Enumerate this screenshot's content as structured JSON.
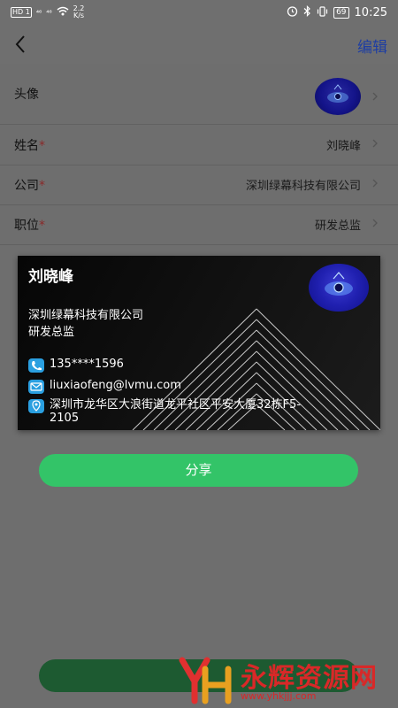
{
  "status_bar": {
    "hd_badge": "HD 1",
    "signal_1": "⁴⁶",
    "signal_2": "⁴⁶",
    "net_speed_value": "2.2",
    "net_speed_unit": "K/s",
    "battery": "69",
    "time": "10:25"
  },
  "header": {
    "edit_label": "编辑"
  },
  "profile": {
    "avatar_label": "头像",
    "fields": [
      {
        "label": "姓名",
        "required_mark": "*",
        "value": "刘晓峰"
      },
      {
        "label": "公司",
        "required_mark": "*",
        "value": "深圳绿幕科技有限公司"
      },
      {
        "label": "职位",
        "required_mark": "*",
        "value": "研发总监"
      }
    ]
  },
  "card": {
    "name": "刘晓峰",
    "company": "深圳绿幕科技有限公司",
    "title": "研发总监",
    "phone": "135****1596",
    "email": "liuxiaofeng@lvmu.com",
    "address": "深圳市龙华区大浪街道龙平社区平安大厦32栋F5-2105"
  },
  "share_label": "分享",
  "watermark": {
    "text": "永辉资源网",
    "url": "www.yhkjjj.com"
  },
  "colors": {
    "accent_green": "#33c468",
    "edit_blue": "#1e3ea3",
    "card_icon_blue": "#2a9fe0"
  }
}
